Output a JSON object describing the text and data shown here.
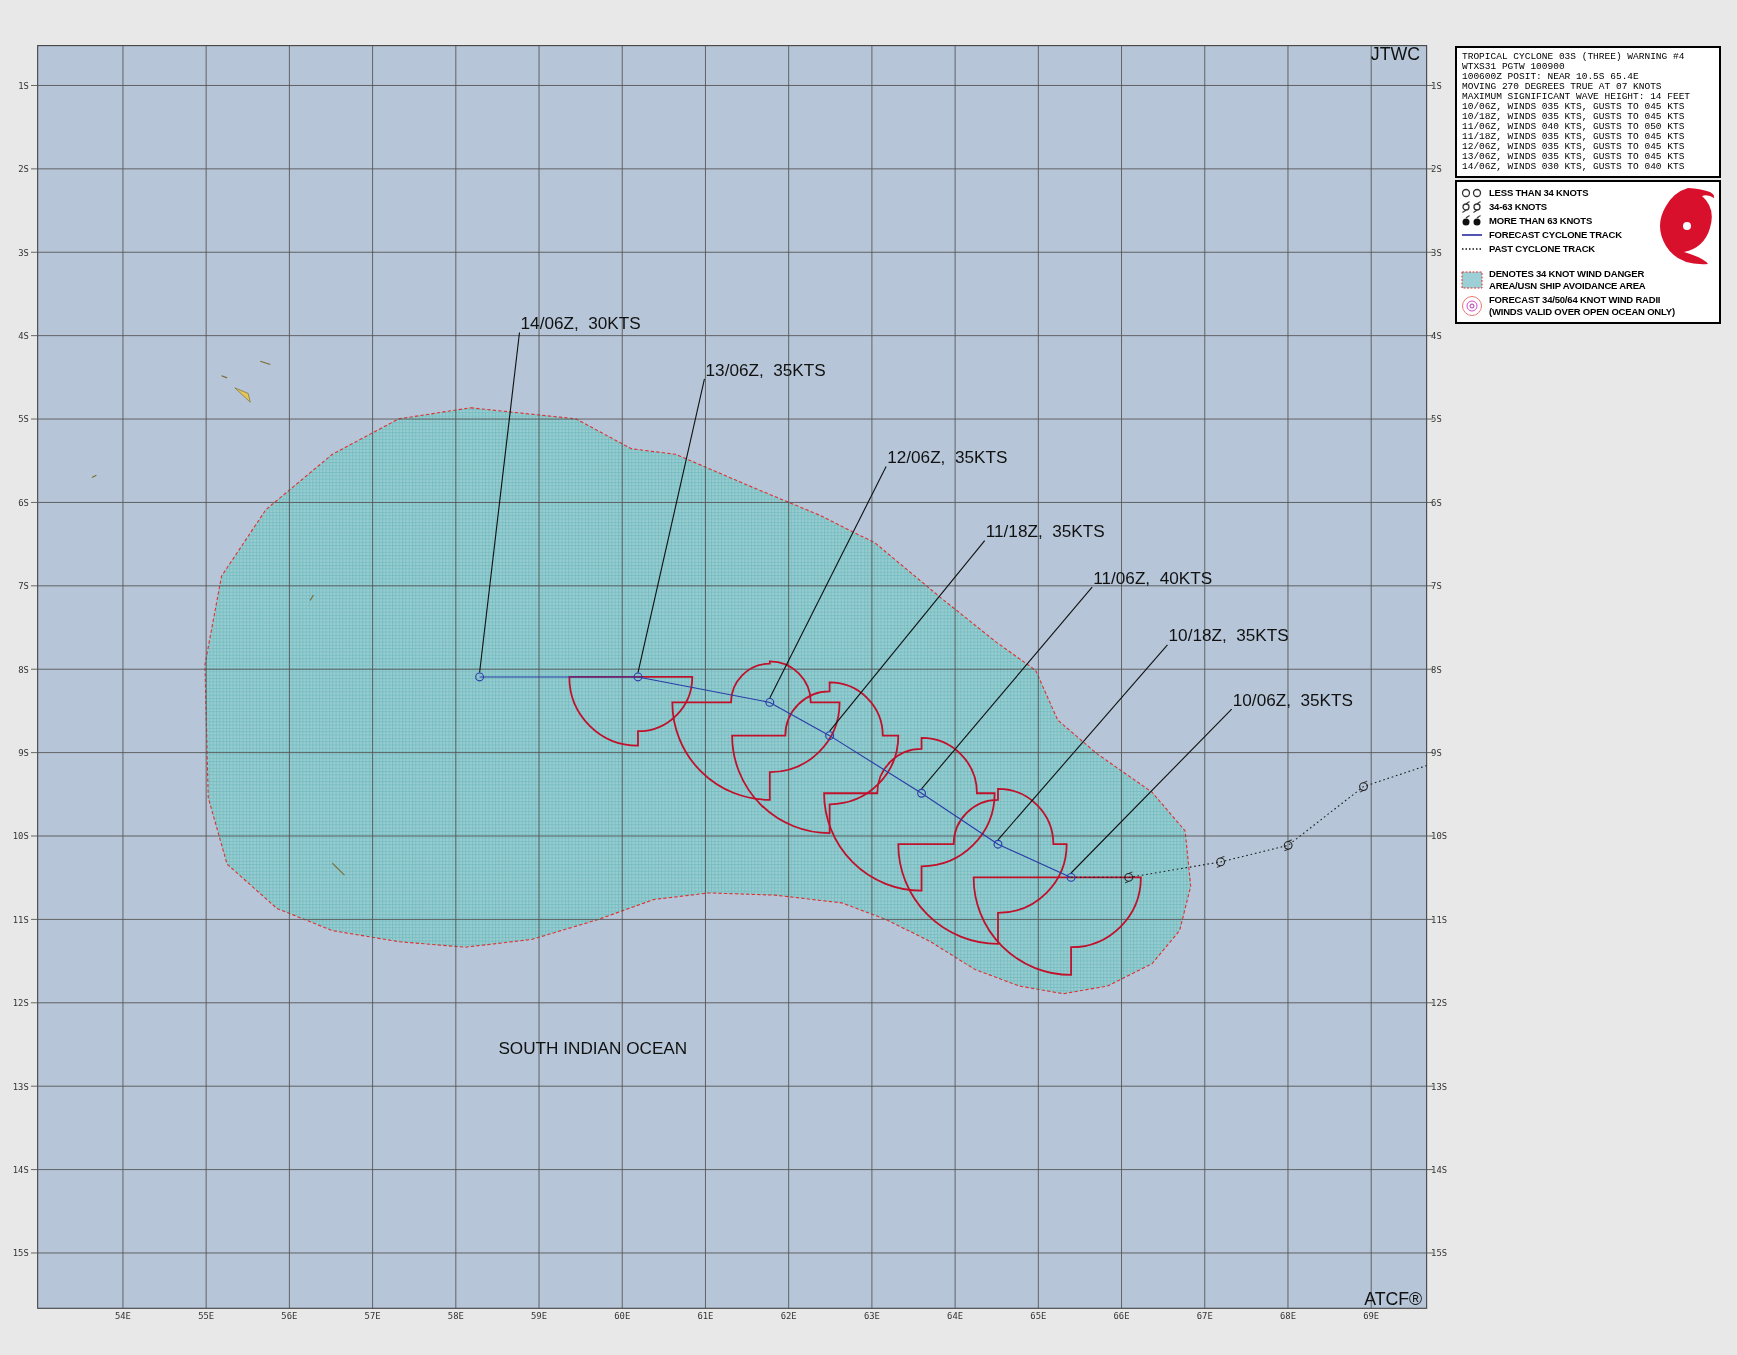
{
  "map": {
    "agency": "JTWC",
    "producer": "ATCF®",
    "ocean_label": "SOUTH INDIAN OCEAN",
    "lat_labels_left": [
      "1S",
      "2S",
      "3S",
      "4S",
      "5S",
      "6S",
      "7S",
      "8S",
      "9S",
      "10S",
      "11S",
      "12S",
      "13S",
      "14S",
      "15S"
    ],
    "lat_labels_right": [
      "1S",
      "2S",
      "3S",
      "4S",
      "5S",
      "6S",
      "7S",
      "8S",
      "9S",
      "10S",
      "11S",
      "12S",
      "13S",
      "14S",
      "15S"
    ],
    "lon_labels": [
      "54E",
      "55E",
      "56E",
      "57E",
      "58E",
      "59E",
      "60E",
      "61E",
      "62E",
      "63E",
      "64E",
      "65E",
      "66E",
      "67E",
      "68E",
      "69E"
    ],
    "forecast_points": [
      {
        "label": "14/06Z,  30KTS"
      },
      {
        "label": "13/06Z,  35KTS"
      },
      {
        "label": "12/06Z,  35KTS"
      },
      {
        "label": "11/18Z,  35KTS"
      },
      {
        "label": "11/06Z,  40KTS"
      },
      {
        "label": "10/18Z,  35KTS"
      },
      {
        "label": "10/06Z,  35KTS"
      }
    ]
  },
  "warning": {
    "lines": [
      "TROPICAL CYCLONE 03S (THREE) WARNING #4",
      "WTXS31 PGTW 100900",
      "100600Z POSIT: NEAR 10.5S 65.4E",
      "MOVING 270 DEGREES TRUE AT 07 KNOTS",
      "MAXIMUM SIGNIFICANT WAVE HEIGHT: 14 FEET",
      "10/06Z, WINDS 035 KTS, GUSTS TO 045 KTS",
      "10/18Z, WINDS 035 KTS, GUSTS TO 045 KTS",
      "11/06Z, WINDS 040 KTS, GUSTS TO 050 KTS",
      "11/18Z, WINDS 035 KTS, GUSTS TO 045 KTS",
      "12/06Z, WINDS 035 KTS, GUSTS TO 045 KTS",
      "13/06Z, WINDS 035 KTS, GUSTS TO 045 KTS",
      "14/06Z, WINDS 030 KTS, GUSTS TO 040 KTS"
    ]
  },
  "legend": {
    "items": [
      {
        "kind": "weak",
        "lines": [
          "LESS THAN 34 KNOTS"
        ]
      },
      {
        "kind": "moderate",
        "lines": [
          "34-63 KNOTS"
        ]
      },
      {
        "kind": "strong",
        "lines": [
          "MORE THAN 63 KNOTS"
        ]
      },
      {
        "kind": "forecast-track",
        "lines": [
          "FORECAST CYCLONE TRACK"
        ]
      },
      {
        "kind": "past-track",
        "lines": [
          "PAST CYCLONE TRACK"
        ]
      },
      {
        "kind": "danger-area",
        "lines": [
          "DENOTES 34 KNOT WIND DANGER",
          "AREA/USN SHIP AVOIDANCE AREA"
        ]
      },
      {
        "kind": "wind-radii",
        "lines": [
          "FORECAST 34/50/64 KNOT WIND RADII",
          "(WINDS VALID OVER OPEN OCEAN ONLY)"
        ]
      }
    ]
  }
}
